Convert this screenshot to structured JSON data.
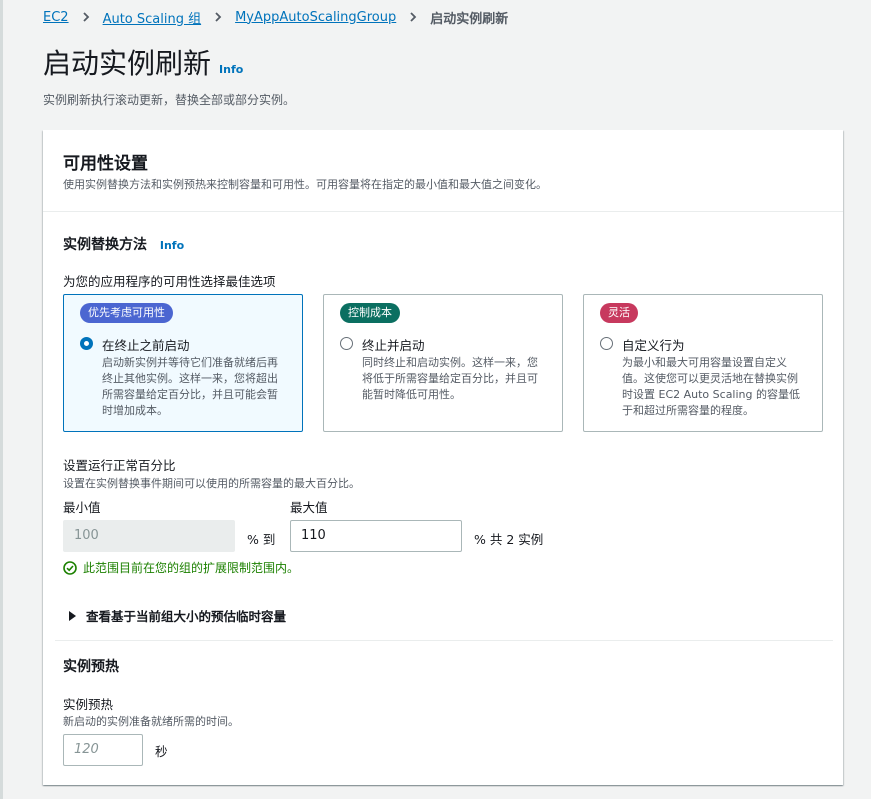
{
  "breadcrumb": {
    "items": [
      "EC2",
      "Auto Scaling 组",
      "MyAppAutoScalingGroup"
    ],
    "current": "启动实例刷新"
  },
  "page": {
    "title": "启动实例刷新",
    "info": "Info",
    "description": "实例刷新执行滚动更新，替换全部或部分实例。"
  },
  "availability": {
    "title": "可用性设置",
    "description": "使用实例替换方法和实例预热来控制容量和可用性。可用容量将在指定的最小值和最大值之间变化。",
    "replacement": {
      "title": "实例替换方法",
      "info": "Info",
      "prompt": "为您的应用程序的可用性选择最佳选项",
      "options": [
        {
          "badge": "优先考虑可用性",
          "badge_color": "#4b66d1",
          "label": "在终止之前启动",
          "description": "启动新实例并等待它们准备就绪后再终止其他实例。这样一来，您将超出所需容量给定百分比，并且可能会暂时增加成本。",
          "selected": true
        },
        {
          "badge": "控制成本",
          "badge_color": "#0b6f61",
          "label": "终止并启动",
          "description": "同时终止和启动实例。这样一来，您将低于所需容量给定百分比，并且可能暂时降低可用性。",
          "selected": false
        },
        {
          "badge": "灵活",
          "badge_color": "#c7395e",
          "label": "自定义行为",
          "description": "为最小和最大可用容量设置自定义值。这使您可以更灵活地在替换实例时设置 EC2 Auto Scaling 的容量低于和超过所需容量的程度。",
          "selected": false
        }
      ]
    },
    "healthy": {
      "title": "设置运行正常百分比",
      "description": "设置在实例替换事件期间可以使用的所需容量的最大百分比。",
      "min_label": "最小值",
      "max_label": "最大值",
      "min_value": "100",
      "max_value": "110",
      "to_text": "% 到",
      "total_text": "% 共 2 实例",
      "success": "此范围目前在您的组的扩展限制范围内。",
      "expand_label": "查看基于当前组大小的预估临时容量"
    },
    "warmup": {
      "title": "实例预热",
      "label": "实例预热",
      "description": "新启动的实例准备就绪所需的时间。",
      "placeholder": "120",
      "unit": "秒"
    }
  }
}
